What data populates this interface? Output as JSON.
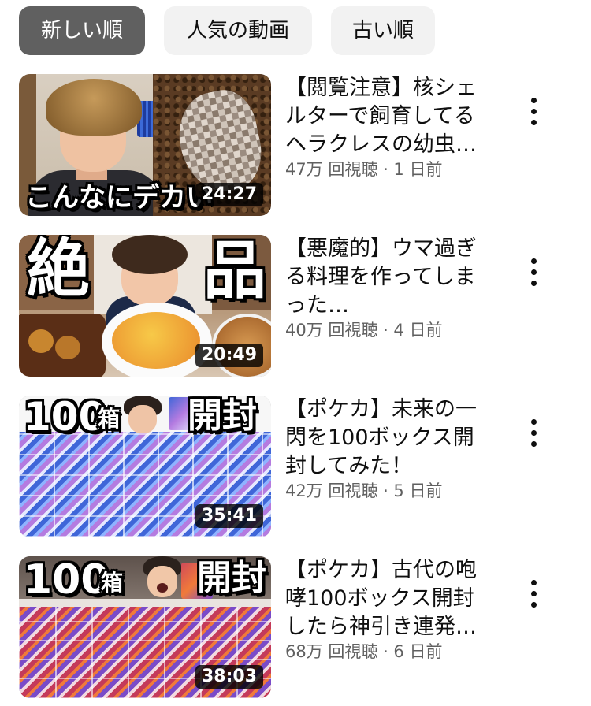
{
  "theme": {
    "text_primary": "#0f0f0f",
    "text_secondary": "#606060",
    "chip_bg": "#f2f2f2",
    "chip_selected_bg": "#606060",
    "chip_selected_text": "#ffffff",
    "badge_bg": "#000000cc",
    "menu_icon_color": "#0f0f0f"
  },
  "filters": [
    {
      "label": "新しい順",
      "selected": true
    },
    {
      "label": "人気の動画",
      "selected": false
    },
    {
      "label": "古い順",
      "selected": false
    }
  ],
  "icons": {
    "video_menu": "more-vert-icon"
  },
  "videos": [
    {
      "title": "【閲覧注意】核シェルターで飼育してるヘラクレスの幼虫…",
      "meta": "47万 回視聴 · 1 日前",
      "duration": "24:27",
      "thumbnail_text": [
        "こんなにデカい"
      ]
    },
    {
      "title": "【悪魔的】ウマ過ぎる料理を作ってしまった…",
      "meta": "40万 回視聴 · 4 日前",
      "duration": "20:49",
      "thumbnail_text": [
        "絶",
        "品"
      ]
    },
    {
      "title": "【ポケカ】未来の一閃を100ボックス開封してみた！",
      "meta": "42万 回視聴 · 5 日前",
      "duration": "35:41",
      "thumbnail_text": [
        "100",
        "箱",
        "開封"
      ]
    },
    {
      "title": "【ポケカ】古代の咆哮100ボックス開封したら神引き連発…",
      "meta": "68万 回視聴 · 6 日前",
      "duration": "38:03",
      "thumbnail_text": [
        "100",
        "箱",
        "開封"
      ]
    }
  ]
}
